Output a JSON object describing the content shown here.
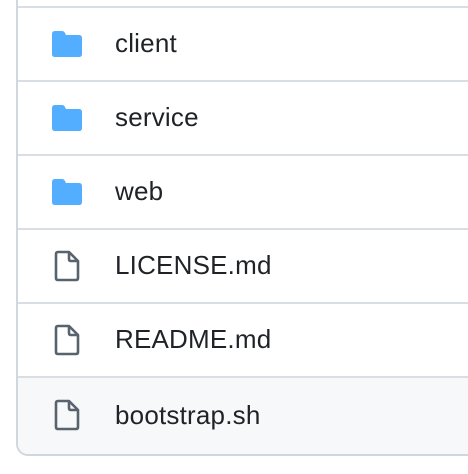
{
  "file_list": {
    "items": [
      {
        "name": "client",
        "type": "folder",
        "icon": "folder-icon"
      },
      {
        "name": "service",
        "type": "folder",
        "icon": "folder-icon"
      },
      {
        "name": "web",
        "type": "folder",
        "icon": "folder-icon"
      },
      {
        "name": "LICENSE.md",
        "type": "file",
        "icon": "file-icon"
      },
      {
        "name": "README.md",
        "type": "file",
        "icon": "file-icon"
      },
      {
        "name": "bootstrap.sh",
        "type": "file",
        "icon": "file-icon",
        "highlighted": true
      }
    ]
  },
  "colors": {
    "folder": "#54aeff",
    "file_icon": "#59636e",
    "text": "#1f2328",
    "border": "#d0d7de",
    "row_hover": "#f6f8fa"
  }
}
